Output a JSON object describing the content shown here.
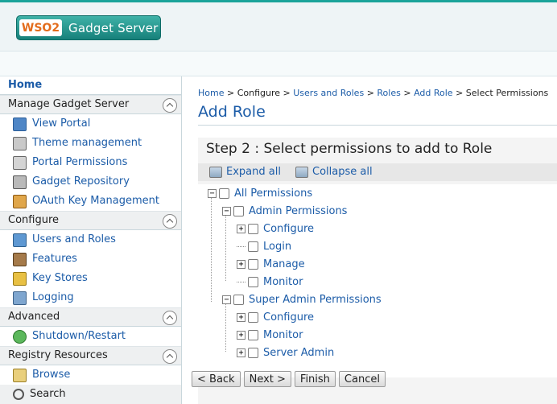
{
  "header": {
    "logo_brand": "WSO2",
    "logo_product": "Gadget Server"
  },
  "sidebar": {
    "home_label": "Home",
    "sections": [
      {
        "title": "Manage Gadget Server",
        "items": [
          "View Portal",
          "Theme management",
          "Portal Permissions",
          "Gadget Repository",
          "OAuth Key Management"
        ]
      },
      {
        "title": "Configure",
        "items": [
          "Users and Roles",
          "Features",
          "Key Stores",
          "Logging"
        ]
      },
      {
        "title": "Advanced",
        "items": [
          "Shutdown/Restart"
        ]
      },
      {
        "title": "Registry Resources",
        "items": [
          "Browse",
          "Search"
        ]
      }
    ]
  },
  "breadcrumb": {
    "home": "Home",
    "configure": "Configure",
    "users_roles": "Users and Roles",
    "roles": "Roles",
    "add_role": "Add Role",
    "current": "Select Permissions",
    "sep": ">"
  },
  "page_title": "Add Role",
  "step_title": "Step 2 : Select permissions to add to Role",
  "toolbar": {
    "expand_all": "Expand all",
    "collapse_all": "Collapse all"
  },
  "tree": {
    "root": "All Permissions",
    "admin": "Admin Permissions",
    "admin_children": [
      "Configure",
      "Login",
      "Manage",
      "Monitor"
    ],
    "super_admin": "Super Admin Permissions",
    "super_admin_children": [
      "Configure",
      "Monitor",
      "Server Admin"
    ]
  },
  "buttons": {
    "back": "< Back",
    "next": "Next >",
    "finish": "Finish",
    "cancel": "Cancel"
  }
}
